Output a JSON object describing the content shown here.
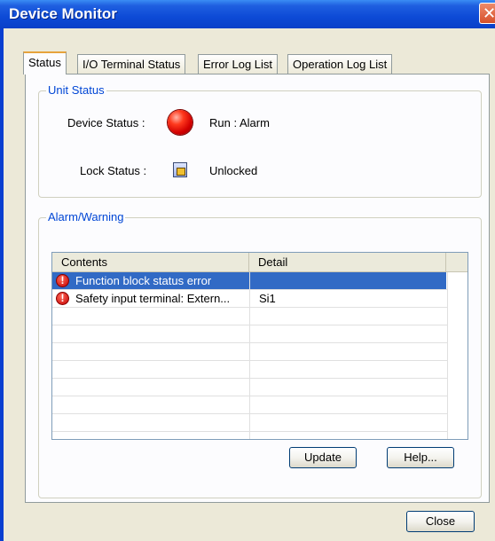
{
  "window": {
    "title": "Device Monitor",
    "close_glyph": "✕"
  },
  "tabs": [
    {
      "label": "Status",
      "active": true
    },
    {
      "label": "I/O Terminal Status",
      "active": false
    },
    {
      "label": "Error Log List",
      "active": false
    },
    {
      "label": "Operation Log List",
      "active": false
    }
  ],
  "unit_status": {
    "legend": "Unit Status",
    "device_status_label": "Device Status :",
    "device_status_icon": "red-led-icon",
    "device_status_value": "Run : Alarm",
    "lock_status_label": "Lock Status :",
    "lock_status_icon": "lock-icon",
    "lock_status_value": "Unlocked"
  },
  "alarm_warning": {
    "legend": "Alarm/Warning",
    "columns": [
      "Contents",
      "Detail"
    ],
    "rows": [
      {
        "icon": "alarm-icon",
        "contents": "Function block status error",
        "detail": "",
        "selected": true
      },
      {
        "icon": "alarm-icon",
        "contents": "Safety input terminal: Extern...",
        "detail": "Si1",
        "selected": false
      }
    ],
    "update_label": "Update",
    "help_label": "Help..."
  },
  "footer": {
    "close_label": "Close"
  },
  "colors": {
    "title_bar": "#0d4ad6",
    "selection": "#316ac5",
    "group_legend": "#0046d5",
    "alarm_red": "#d20000"
  }
}
